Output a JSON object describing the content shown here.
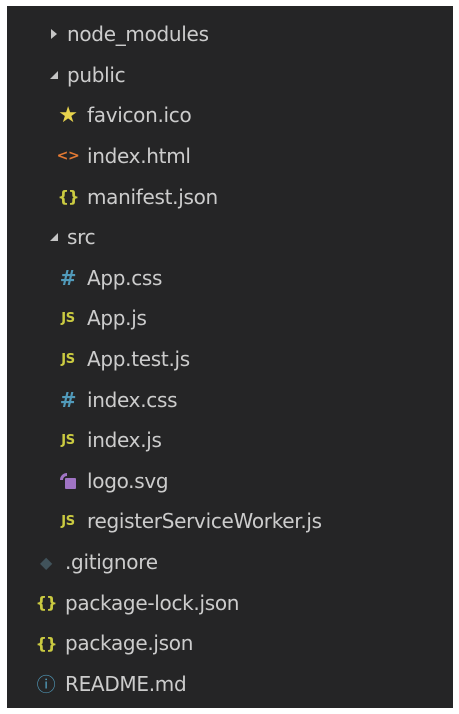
{
  "colors": {
    "panel_bg": "#252526",
    "text": "#cccccc",
    "js": "#cbcb41",
    "css": "#519aba",
    "json": "#cbcb41",
    "html": "#e37933",
    "star": "#e8d44d",
    "svg": "#a074c4",
    "git": "#41535b",
    "info": "#519aba"
  },
  "tree": [
    {
      "label": "node_modules",
      "kind": "folder",
      "expanded": false,
      "icon": "chevron-right-icon"
    },
    {
      "label": "public",
      "kind": "folder",
      "expanded": true,
      "icon": "chevron-down-icon"
    },
    {
      "label": "favicon.ico",
      "kind": "file",
      "icon": "star-icon",
      "glyph": "★"
    },
    {
      "label": "index.html",
      "kind": "file",
      "icon": "html-icon",
      "glyph": "<>"
    },
    {
      "label": "manifest.json",
      "kind": "file",
      "icon": "json-icon",
      "glyph": "{}"
    },
    {
      "label": "src",
      "kind": "folder",
      "expanded": true,
      "icon": "chevron-down-icon"
    },
    {
      "label": "App.css",
      "kind": "file",
      "icon": "css-icon",
      "glyph": "#"
    },
    {
      "label": "App.js",
      "kind": "file",
      "icon": "js-icon",
      "glyph": "JS"
    },
    {
      "label": "App.test.js",
      "kind": "file",
      "icon": "js-icon",
      "glyph": "JS"
    },
    {
      "label": "index.css",
      "kind": "file",
      "icon": "css-icon",
      "glyph": "#"
    },
    {
      "label": "index.js",
      "kind": "file",
      "icon": "js-icon",
      "glyph": "JS"
    },
    {
      "label": "logo.svg",
      "kind": "file",
      "icon": "svg-icon",
      "glyph": ""
    },
    {
      "label": "registerServiceWorker.js",
      "kind": "file",
      "icon": "js-icon",
      "glyph": "JS"
    },
    {
      "label": ".gitignore",
      "kind": "file",
      "icon": "git-icon",
      "glyph": "◆"
    },
    {
      "label": "package-lock.json",
      "kind": "file",
      "icon": "json-icon",
      "glyph": "{}"
    },
    {
      "label": "package.json",
      "kind": "file",
      "icon": "json-icon",
      "glyph": "{}"
    },
    {
      "label": "README.md",
      "kind": "file",
      "icon": "info-icon",
      "glyph": "ⓘ"
    }
  ]
}
